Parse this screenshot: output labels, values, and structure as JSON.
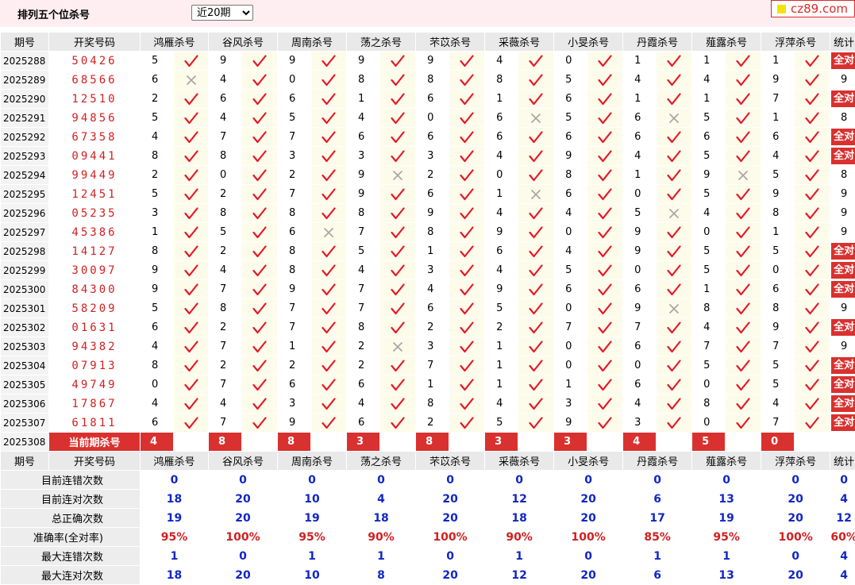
{
  "page_title": "排列五个位杀号",
  "period_select": {
    "selected": "近20期"
  },
  "logo_text": "cz89.com",
  "headers": [
    "期号",
    "开奖号码",
    "鸿雁杀号",
    "谷风杀号",
    "周南杀号",
    "荡之杀号",
    "芣苡杀号",
    "采薇杀号",
    "小旻杀号",
    "丹霞杀号",
    "薤露杀号",
    "浮萍杀号",
    "统计"
  ],
  "colors": {
    "accent_red": "#d9312f",
    "stat_blue": "#1226c6",
    "mark_bg": "#fdfbea"
  },
  "all_right_label": "全对",
  "rows": [
    {
      "issue": "2025288",
      "draw": "50426",
      "kills": [
        5,
        9,
        9,
        9,
        9,
        4,
        0,
        1,
        1,
        1
      ],
      "ok": [
        1,
        1,
        1,
        1,
        1,
        1,
        1,
        1,
        1,
        1
      ],
      "stat": "全对"
    },
    {
      "issue": "2025289",
      "draw": "68566",
      "kills": [
        6,
        4,
        0,
        8,
        8,
        8,
        5,
        4,
        4,
        9
      ],
      "ok": [
        0,
        1,
        1,
        1,
        1,
        1,
        1,
        1,
        1,
        1
      ],
      "stat": "9"
    },
    {
      "issue": "2025290",
      "draw": "12510",
      "kills": [
        2,
        6,
        6,
        1,
        6,
        1,
        6,
        1,
        1,
        7
      ],
      "ok": [
        1,
        1,
        1,
        1,
        1,
        1,
        1,
        1,
        1,
        1
      ],
      "stat": "全对"
    },
    {
      "issue": "2025291",
      "draw": "94856",
      "kills": [
        5,
        4,
        5,
        4,
        0,
        6,
        5,
        6,
        5,
        1
      ],
      "ok": [
        1,
        1,
        1,
        1,
        1,
        0,
        1,
        0,
        1,
        1
      ],
      "stat": "8"
    },
    {
      "issue": "2025292",
      "draw": "67358",
      "kills": [
        4,
        7,
        7,
        6,
        6,
        6,
        6,
        6,
        6,
        6
      ],
      "ok": [
        1,
        1,
        1,
        1,
        1,
        1,
        1,
        1,
        1,
        1
      ],
      "stat": "全对"
    },
    {
      "issue": "2025293",
      "draw": "09441",
      "kills": [
        8,
        8,
        3,
        3,
        3,
        4,
        9,
        4,
        5,
        4
      ],
      "ok": [
        1,
        1,
        1,
        1,
        1,
        1,
        1,
        1,
        1,
        1
      ],
      "stat": "全对"
    },
    {
      "issue": "2025294",
      "draw": "99449",
      "kills": [
        2,
        0,
        2,
        9,
        2,
        0,
        8,
        1,
        9,
        5
      ],
      "ok": [
        1,
        1,
        1,
        0,
        1,
        1,
        1,
        1,
        0,
        1
      ],
      "stat": "8"
    },
    {
      "issue": "2025295",
      "draw": "12451",
      "kills": [
        5,
        2,
        7,
        9,
        6,
        1,
        6,
        0,
        5,
        9
      ],
      "ok": [
        1,
        1,
        1,
        1,
        1,
        0,
        1,
        1,
        1,
        1
      ],
      "stat": "9"
    },
    {
      "issue": "2025296",
      "draw": "05235",
      "kills": [
        3,
        8,
        8,
        8,
        9,
        4,
        4,
        5,
        4,
        8
      ],
      "ok": [
        1,
        1,
        1,
        1,
        1,
        1,
        1,
        0,
        1,
        1
      ],
      "stat": "9"
    },
    {
      "issue": "2025297",
      "draw": "45386",
      "kills": [
        1,
        5,
        6,
        7,
        8,
        9,
        0,
        9,
        0,
        1
      ],
      "ok": [
        1,
        1,
        0,
        1,
        1,
        1,
        1,
        1,
        1,
        1
      ],
      "stat": "9"
    },
    {
      "issue": "2025298",
      "draw": "14127",
      "kills": [
        8,
        2,
        8,
        5,
        1,
        6,
        4,
        9,
        5,
        5
      ],
      "ok": [
        1,
        1,
        1,
        1,
        1,
        1,
        1,
        1,
        1,
        1
      ],
      "stat": "全对"
    },
    {
      "issue": "2025299",
      "draw": "30097",
      "kills": [
        9,
        4,
        8,
        4,
        3,
        4,
        5,
        0,
        5,
        0
      ],
      "ok": [
        1,
        1,
        1,
        1,
        1,
        1,
        1,
        1,
        1,
        1
      ],
      "stat": "全对"
    },
    {
      "issue": "2025300",
      "draw": "84300",
      "kills": [
        9,
        7,
        9,
        7,
        4,
        9,
        6,
        6,
        1,
        6
      ],
      "ok": [
        1,
        1,
        1,
        1,
        1,
        1,
        1,
        1,
        1,
        1
      ],
      "stat": "全对"
    },
    {
      "issue": "2025301",
      "draw": "58209",
      "kills": [
        5,
        8,
        7,
        7,
        6,
        5,
        0,
        9,
        8,
        8
      ],
      "ok": [
        1,
        1,
        1,
        1,
        1,
        1,
        1,
        0,
        1,
        1
      ],
      "stat": "9"
    },
    {
      "issue": "2025302",
      "draw": "01631",
      "kills": [
        6,
        2,
        7,
        8,
        2,
        2,
        7,
        7,
        4,
        9
      ],
      "ok": [
        1,
        1,
        1,
        1,
        1,
        1,
        1,
        1,
        1,
        1
      ],
      "stat": "全对"
    },
    {
      "issue": "2025303",
      "draw": "94382",
      "kills": [
        4,
        7,
        1,
        2,
        3,
        1,
        0,
        6,
        7,
        7
      ],
      "ok": [
        1,
        1,
        1,
        0,
        1,
        1,
        1,
        1,
        1,
        1
      ],
      "stat": "9"
    },
    {
      "issue": "2025304",
      "draw": "07913",
      "kills": [
        8,
        2,
        2,
        2,
        7,
        1,
        0,
        0,
        5,
        5
      ],
      "ok": [
        1,
        1,
        1,
        1,
        1,
        1,
        1,
        1,
        1,
        1
      ],
      "stat": "全对"
    },
    {
      "issue": "2025305",
      "draw": "49749",
      "kills": [
        0,
        7,
        6,
        6,
        1,
        1,
        1,
        6,
        0,
        5
      ],
      "ok": [
        1,
        1,
        1,
        1,
        1,
        1,
        1,
        1,
        1,
        1
      ],
      "stat": "全对"
    },
    {
      "issue": "2025306",
      "draw": "17867",
      "kills": [
        4,
        4,
        3,
        4,
        8,
        4,
        3,
        4,
        8,
        4
      ],
      "ok": [
        1,
        1,
        1,
        1,
        1,
        1,
        1,
        1,
        1,
        1
      ],
      "stat": "全对"
    },
    {
      "issue": "2025307",
      "draw": "61811",
      "kills": [
        6,
        7,
        9,
        6,
        2,
        5,
        9,
        3,
        0,
        7
      ],
      "ok": [
        1,
        1,
        1,
        1,
        1,
        1,
        1,
        1,
        1,
        1
      ],
      "stat": "全对"
    }
  ],
  "current": {
    "issue": "2025308",
    "label": "当前期杀号",
    "kills": [
      4,
      8,
      8,
      3,
      8,
      3,
      3,
      4,
      5,
      0
    ]
  },
  "stats": [
    {
      "label": "目前连错次数",
      "values": [
        "0",
        "0",
        "0",
        "0",
        "0",
        "0",
        "0",
        "0",
        "0",
        "0",
        "0"
      ]
    },
    {
      "label": "目前连对次数",
      "values": [
        "18",
        "20",
        "10",
        "4",
        "20",
        "12",
        "20",
        "6",
        "13",
        "20",
        "4"
      ]
    },
    {
      "label": "总正确次数",
      "values": [
        "19",
        "20",
        "19",
        "18",
        "20",
        "18",
        "20",
        "17",
        "19",
        "20",
        "12"
      ]
    },
    {
      "label": "准确率(全对率)",
      "values": [
        "95%",
        "100%",
        "95%",
        "90%",
        "100%",
        "90%",
        "100%",
        "85%",
        "95%",
        "100%",
        "60%"
      ]
    },
    {
      "label": "最大连错次数",
      "values": [
        "1",
        "0",
        "1",
        "1",
        "0",
        "1",
        "0",
        "1",
        "1",
        "0",
        "4"
      ]
    },
    {
      "label": "最大连对次数",
      "values": [
        "18",
        "20",
        "10",
        "8",
        "20",
        "12",
        "20",
        "6",
        "13",
        "20",
        "4"
      ]
    }
  ]
}
